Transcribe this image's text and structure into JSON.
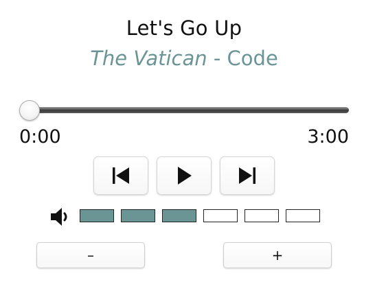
{
  "track": {
    "title": "Let's Go Up",
    "album": "The Vatican",
    "separator": " - ",
    "artist": "Code"
  },
  "progress": {
    "current": "0:00",
    "total": "3:00",
    "fraction": 0
  },
  "controls": {
    "previous_icon": "skip-previous-icon",
    "play_icon": "play-icon",
    "next_icon": "skip-next-icon"
  },
  "volume": {
    "icon": "speaker-icon",
    "level": 3,
    "max": 6
  },
  "volume_buttons": {
    "decrease_label": "–",
    "increase_label": "+"
  },
  "colors": {
    "accent": "#6b9495",
    "text": "#111111"
  }
}
